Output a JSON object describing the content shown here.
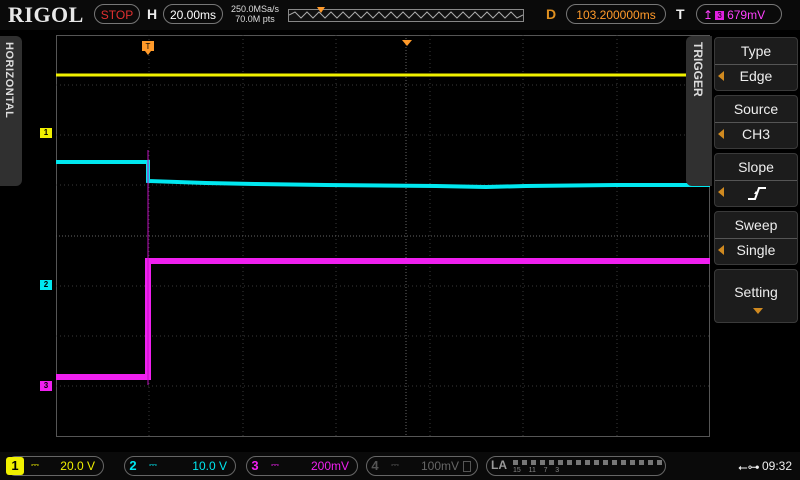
{
  "brand": "RIGOL",
  "top": {
    "run_state": "STOP",
    "h_label": "H",
    "timebase": "20.00ms",
    "sample_rate": "250.0MSa/s",
    "memory_depth": "70.0M pts",
    "d_label": "D",
    "delay": "103.200000ms",
    "t_label": "T",
    "trigger_level": "679mV"
  },
  "left_tab": "HORIZONTAL",
  "trigger_menu": {
    "tab": "TRIGGER",
    "items": [
      {
        "title": "Type",
        "value": "Edge"
      },
      {
        "title": "Source",
        "value": "CH3"
      },
      {
        "title": "Slope",
        "value": ""
      },
      {
        "title": "Sweep",
        "value": "Single"
      },
      {
        "title": "Setting",
        "value": ""
      }
    ]
  },
  "channels": [
    {
      "num": "1",
      "coupling": "⎓",
      "scale": "20.0 V",
      "color": "#f0f000"
    },
    {
      "num": "2",
      "coupling": "⎓",
      "scale": "10.0 V",
      "color": "#00e8f0"
    },
    {
      "num": "3",
      "coupling": "⎓",
      "scale": "200mV",
      "color": "#f020f0"
    },
    {
      "num": "4",
      "coupling": "⎓",
      "scale": "100mV",
      "color": "#555555"
    }
  ],
  "la": {
    "label": "LA",
    "groups": "15    11    7    3"
  },
  "clock": "09:32",
  "colors": {
    "ch1": "#f0f000",
    "ch2": "#00e8f0",
    "ch3": "#f020f0",
    "trigger": "#ff9a2a",
    "grid": "#404040"
  }
}
